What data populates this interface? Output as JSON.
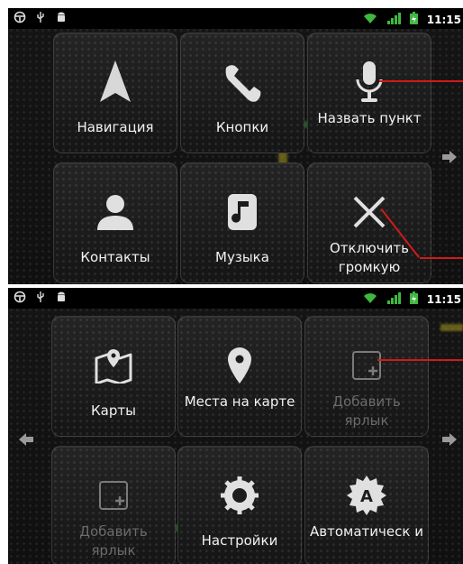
{
  "status_bar": {
    "time": "11:15"
  },
  "screen1": {
    "tiles": [
      {
        "label": "Навигация",
        "icon": "navigation-arrow-icon"
      },
      {
        "label": "Кнопки",
        "icon": "phone-handset-icon"
      },
      {
        "label": "Назвать пункт",
        "icon": "microphone-icon"
      },
      {
        "label": "Контакты",
        "icon": "contact-person-icon"
      },
      {
        "label": "Музыка",
        "icon": "music-note-icon"
      },
      {
        "label": "Отключить громкую",
        "icon": "close-x-icon"
      }
    ]
  },
  "screen2": {
    "tiles": [
      {
        "label": "Карты",
        "icon": "map-pin-icon"
      },
      {
        "label": "Места на карте",
        "icon": "location-pin-icon"
      },
      {
        "label": "Добавить ярлык",
        "icon": "add-shortcut-icon",
        "disabled": true
      },
      {
        "label": "Добавить ярлык",
        "icon": "add-shortcut-icon",
        "disabled": true
      },
      {
        "label": "Настройки",
        "icon": "settings-gear-icon"
      },
      {
        "label": "Автоматическ и",
        "icon": "auto-a-icon"
      }
    ]
  },
  "colors": {
    "accent_line": "#d01a1a",
    "disabled_text": "#6b6b6b",
    "text": "#f2f2f2"
  }
}
